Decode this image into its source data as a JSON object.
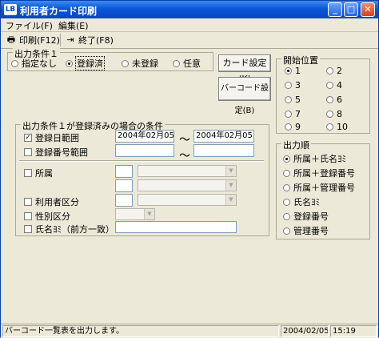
{
  "window": {
    "icon_text": "LB",
    "title": "利用者カード印刷",
    "minimize": "_",
    "maximize": "□",
    "close": "✕"
  },
  "menu": [
    {
      "label": "ファイル(F)"
    },
    {
      "label": "編集(E)"
    }
  ],
  "toolbar": {
    "print_label": "印刷(F12)",
    "exit_label": "終了(F8)"
  },
  "output_condition1": {
    "title": "出力条件１",
    "options": [
      {
        "label": "指定なし",
        "selected": false
      },
      {
        "label": "登録済",
        "selected": true
      },
      {
        "label": "未登録",
        "selected": false
      },
      {
        "label": "任意",
        "selected": false
      }
    ]
  },
  "buttons": {
    "card_settings": "カード設定(K)",
    "barcode_settings": "バーコード設定(B)"
  },
  "start_position": {
    "title": "開始位置",
    "selected": "1",
    "options": [
      "1",
      "2",
      "3",
      "4",
      "5",
      "6",
      "7",
      "8",
      "9",
      "10"
    ]
  },
  "output_condition_registered": {
    "title": "出力条件１が登録済みの場合の条件",
    "registration_date": {
      "label": "登録日範囲",
      "checked": true,
      "from": "2004年02月05日",
      "to": "2004年02月05日"
    },
    "registration_number": {
      "label": "登録番号範囲",
      "checked": false,
      "from": "",
      "to": ""
    },
    "tilde": "～",
    "affiliation_label": "所属",
    "user_category_label": "利用者区分",
    "gender_label": "性別区分",
    "name_kana_label": "氏名ﾖﾐ（前方一致）"
  },
  "output_order": {
    "title": "出力順",
    "selected_index": 0,
    "options": [
      "所属＋氏名ﾖﾐ",
      "所属＋登録番号",
      "所属＋管理番号",
      "氏名ﾖﾐ",
      "登録番号",
      "管理番号"
    ]
  },
  "status": {
    "message": "バーコード一覧表を出力します。",
    "date": "2004/02/05",
    "time": "15:19"
  }
}
